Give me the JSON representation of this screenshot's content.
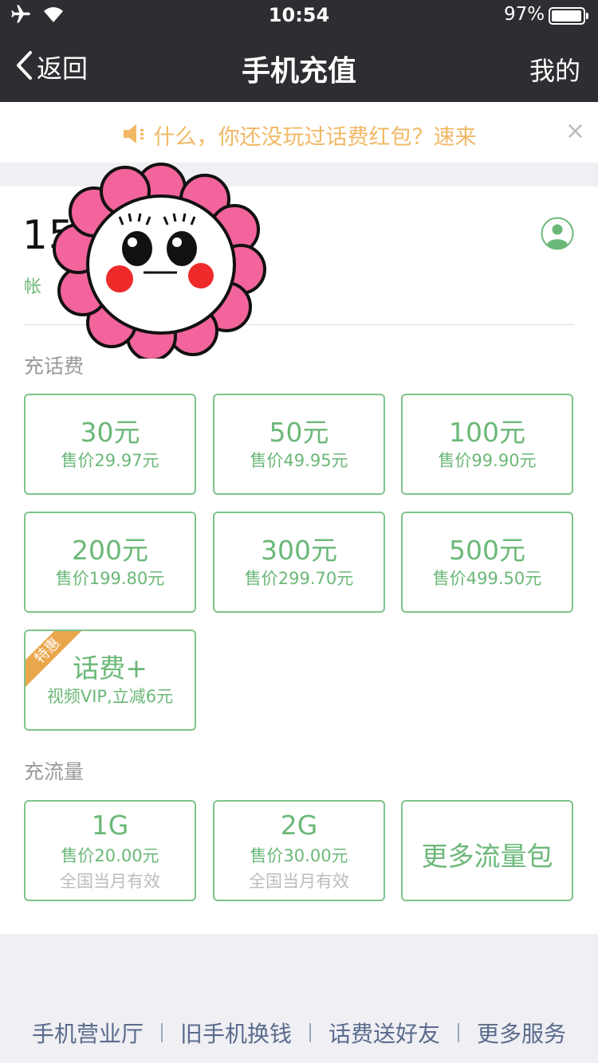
{
  "status_bar": {
    "time": "10:54",
    "battery": "97%",
    "battery_level": 0.97
  },
  "nav": {
    "back_label": "返回",
    "title": "手机充值",
    "right_label": "我的"
  },
  "notice": {
    "text": "什么，你还没玩过话费红包？速来",
    "close": "×"
  },
  "account": {
    "phone": "15          511",
    "label": "帐"
  },
  "sections": {
    "phone_fee": "充话费",
    "data": "充流量"
  },
  "phone_fee_options": [
    {
      "amount": "30元",
      "price": "售价29.97元"
    },
    {
      "amount": "50元",
      "price": "售价49.95元"
    },
    {
      "amount": "100元",
      "price": "售价99.90元"
    },
    {
      "amount": "200元",
      "price": "售价199.80元"
    },
    {
      "amount": "300元",
      "price": "售价299.70元"
    },
    {
      "amount": "500元",
      "price": "售价499.50元"
    }
  ],
  "special": {
    "badge": "特惠",
    "title": "话费+",
    "subtitle": "视频VIP,立减6元"
  },
  "data_options": [
    {
      "amount": "1G",
      "price": "售价20.00元",
      "validity": "全国当月有效"
    },
    {
      "amount": "2G",
      "price": "售价30.00元",
      "validity": "全国当月有效"
    }
  ],
  "more_data": "更多流量包",
  "footer_links": [
    "手机营业厅",
    "旧手机换钱",
    "话费送好友",
    "更多服务"
  ],
  "colors": {
    "accent": "#6bb878",
    "nav_bg": "#2e2e32",
    "notice_text": "#f1b966",
    "badge": "#e9a64a",
    "link": "#5a6b8c"
  },
  "icons": [
    "airplane-icon",
    "wifi-icon",
    "battery-icon",
    "back-chevron-icon",
    "speaker-icon",
    "close-icon",
    "contact-icon"
  ]
}
